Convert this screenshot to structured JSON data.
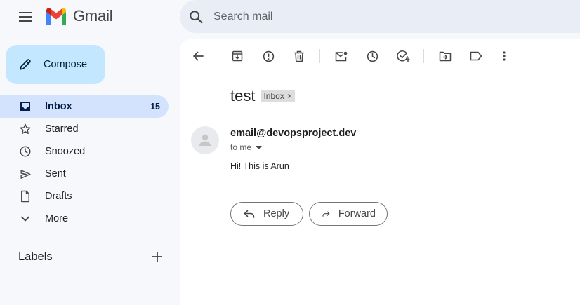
{
  "app": {
    "name": "Gmail"
  },
  "search": {
    "placeholder": "Search mail"
  },
  "compose": {
    "label": "Compose"
  },
  "sidebar": {
    "items": [
      {
        "label": "Inbox",
        "count": "15",
        "icon": "inbox-icon",
        "active": true
      },
      {
        "label": "Starred",
        "icon": "star-icon"
      },
      {
        "label": "Snoozed",
        "icon": "clock-icon"
      },
      {
        "label": "Sent",
        "icon": "send-icon"
      },
      {
        "label": "Drafts",
        "icon": "draft-icon"
      },
      {
        "label": "More",
        "icon": "chevron-down-icon"
      }
    ],
    "labels_heading": "Labels"
  },
  "toolbar": {
    "icons": [
      "back-icon",
      "archive-icon",
      "report-spam-icon",
      "delete-icon",
      "mark-unread-icon",
      "snooze-icon",
      "add-to-tasks-icon",
      "move-to-icon",
      "label-icon",
      "more-vert-icon"
    ]
  },
  "message": {
    "subject": "test",
    "label_chip": "Inbox",
    "chip_close": "×",
    "sender": "email@devopsproject.dev",
    "recipient": "to me",
    "body": "Hi! This is Arun"
  },
  "actions": {
    "reply": "Reply",
    "forward": "Forward"
  },
  "colors": {
    "accent": "#c2e7ff",
    "active_nav": "#d3e3fd",
    "background": "#f6f8fc",
    "search_bg": "#e9eef6"
  }
}
